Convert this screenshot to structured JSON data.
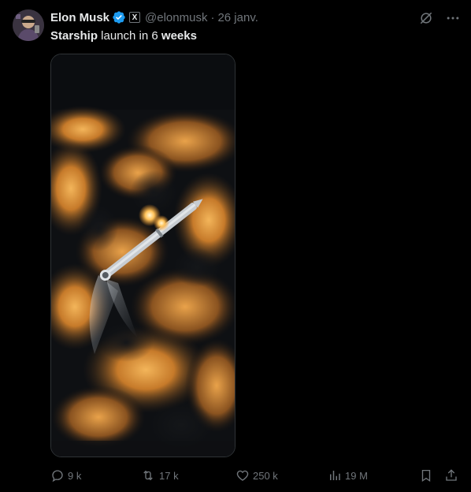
{
  "author": {
    "name": "Elon Musk",
    "handle": "@elonmusk",
    "separator": "·",
    "date": "26 janv.",
    "verified_color": "#1d9bf0",
    "affiliate_badge": "X"
  },
  "tweet": {
    "text_part1": "Starship",
    "text_part2": " launch in 6 ",
    "text_part3": "weeks"
  },
  "media": {
    "type": "video",
    "description_icon": "rocket-launch-image"
  },
  "actions": {
    "reply_count": "9 k",
    "retweet_count": "17 k",
    "like_count": "250 k",
    "views_count": "19 M"
  },
  "icons": {
    "grok": "grok-icon",
    "more": "more-icon",
    "reply": "reply-icon",
    "retweet": "retweet-icon",
    "like": "heart-icon",
    "views": "views-icon",
    "bookmark": "bookmark-icon",
    "share": "share-icon"
  },
  "colors": {
    "background": "#000000",
    "text": "#e7e9ea",
    "muted": "#71767b",
    "accent": "#1d9bf0"
  }
}
